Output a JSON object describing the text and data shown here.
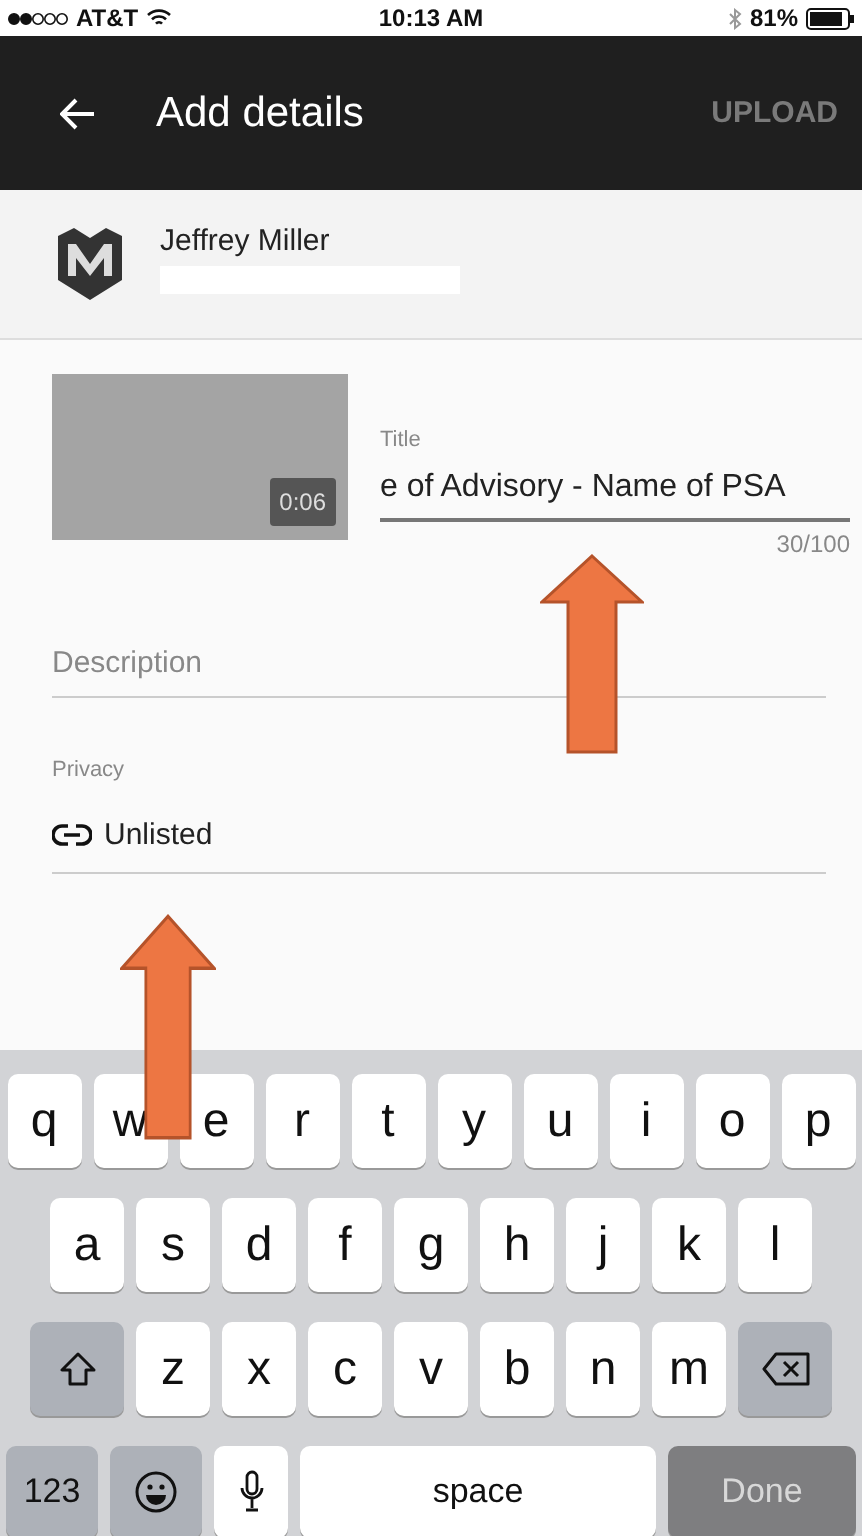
{
  "status_bar": {
    "carrier": "AT&T",
    "time": "10:13 AM",
    "battery": "81%"
  },
  "header": {
    "title": "Add details",
    "action": "UPLOAD"
  },
  "account": {
    "name": "Jeffrey Miller"
  },
  "video": {
    "duration": "0:06"
  },
  "title_field": {
    "label": "Title",
    "value": "e of Advisory - Name of PSA",
    "counter": "30/100"
  },
  "description_field": {
    "placeholder": "Description"
  },
  "privacy": {
    "label": "Privacy",
    "value": "Unlisted"
  },
  "keyboard": {
    "row_1": [
      {
        "kind": "letter",
        "label": "q"
      },
      {
        "kind": "letter",
        "label": "w"
      },
      {
        "kind": "letter",
        "label": "e"
      },
      {
        "kind": "letter",
        "label": "r"
      },
      {
        "kind": "letter",
        "label": "t"
      },
      {
        "kind": "letter",
        "label": "y"
      },
      {
        "kind": "letter",
        "label": "u"
      },
      {
        "kind": "letter",
        "label": "i"
      },
      {
        "kind": "letter",
        "label": "o"
      },
      {
        "kind": "letter",
        "label": "p"
      }
    ],
    "row_2": [
      {
        "kind": "letter",
        "label": "a"
      },
      {
        "kind": "letter",
        "label": "s"
      },
      {
        "kind": "letter",
        "label": "d"
      },
      {
        "kind": "letter",
        "label": "f"
      },
      {
        "kind": "letter",
        "label": "g"
      },
      {
        "kind": "letter",
        "label": "h"
      },
      {
        "kind": "letter",
        "label": "j"
      },
      {
        "kind": "letter",
        "label": "k"
      },
      {
        "kind": "letter",
        "label": "l"
      }
    ],
    "row_3": [
      {
        "kind": "shift"
      },
      {
        "kind": "letter",
        "label": "z"
      },
      {
        "kind": "letter",
        "label": "x"
      },
      {
        "kind": "letter",
        "label": "c"
      },
      {
        "kind": "letter",
        "label": "v"
      },
      {
        "kind": "letter",
        "label": "b"
      },
      {
        "kind": "letter",
        "label": "n"
      },
      {
        "kind": "letter",
        "label": "m"
      },
      {
        "kind": "backspace"
      }
    ],
    "bottom_row": [
      {
        "kind": "numbers",
        "label": "123"
      },
      {
        "kind": "emoji"
      },
      {
        "kind": "mic"
      },
      {
        "kind": "space",
        "label": "space"
      },
      {
        "kind": "done",
        "label": "Done"
      }
    ]
  }
}
